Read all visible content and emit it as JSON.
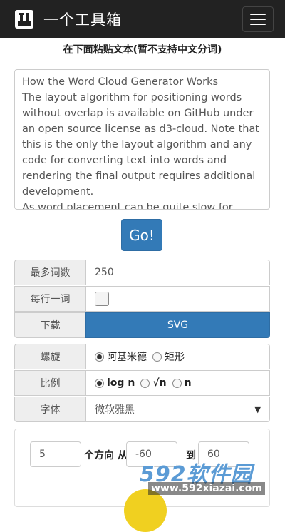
{
  "header": {
    "brand": "一个工具箱",
    "logo_icon": "toolbox-icon",
    "menu_icon": "hamburger-icon"
  },
  "heading": "在下面粘贴文本(暂不支持中文分词)",
  "textarea": {
    "value": "How the Word Cloud Generator Works\nThe layout algorithm for positioning words without overlap is available on GitHub under an open source license as d3-cloud. Note that this is the only the layout algorithm and any code for converting text into words and rendering the final output requires additional development.\nAs word placement can be quite slow for more than a few hundred words, the layout algorithm can be run"
  },
  "go_label": "Go!",
  "options": {
    "max_words_label": "最多词数",
    "max_words_value": "250",
    "one_per_line_label": "每行一词",
    "download_label": "下载",
    "download_button": "SVG",
    "spiral_label": "螺旋",
    "spiral_options": [
      "阿基米德",
      "矩形"
    ],
    "scale_label": "比例",
    "scale_options": [
      "log n",
      "√n",
      "n"
    ],
    "font_label": "字体",
    "font_value": "微软雅黑"
  },
  "orientation": {
    "count": "5",
    "text_from": "个方向 从",
    "from_value": "-60",
    "text_to": "到",
    "to_value": "60"
  },
  "watermark": {
    "brand": "592软件园",
    "url": "www.592xiazai.com"
  },
  "colors": {
    "primary": "#337ab7",
    "navbar": "#222222"
  }
}
